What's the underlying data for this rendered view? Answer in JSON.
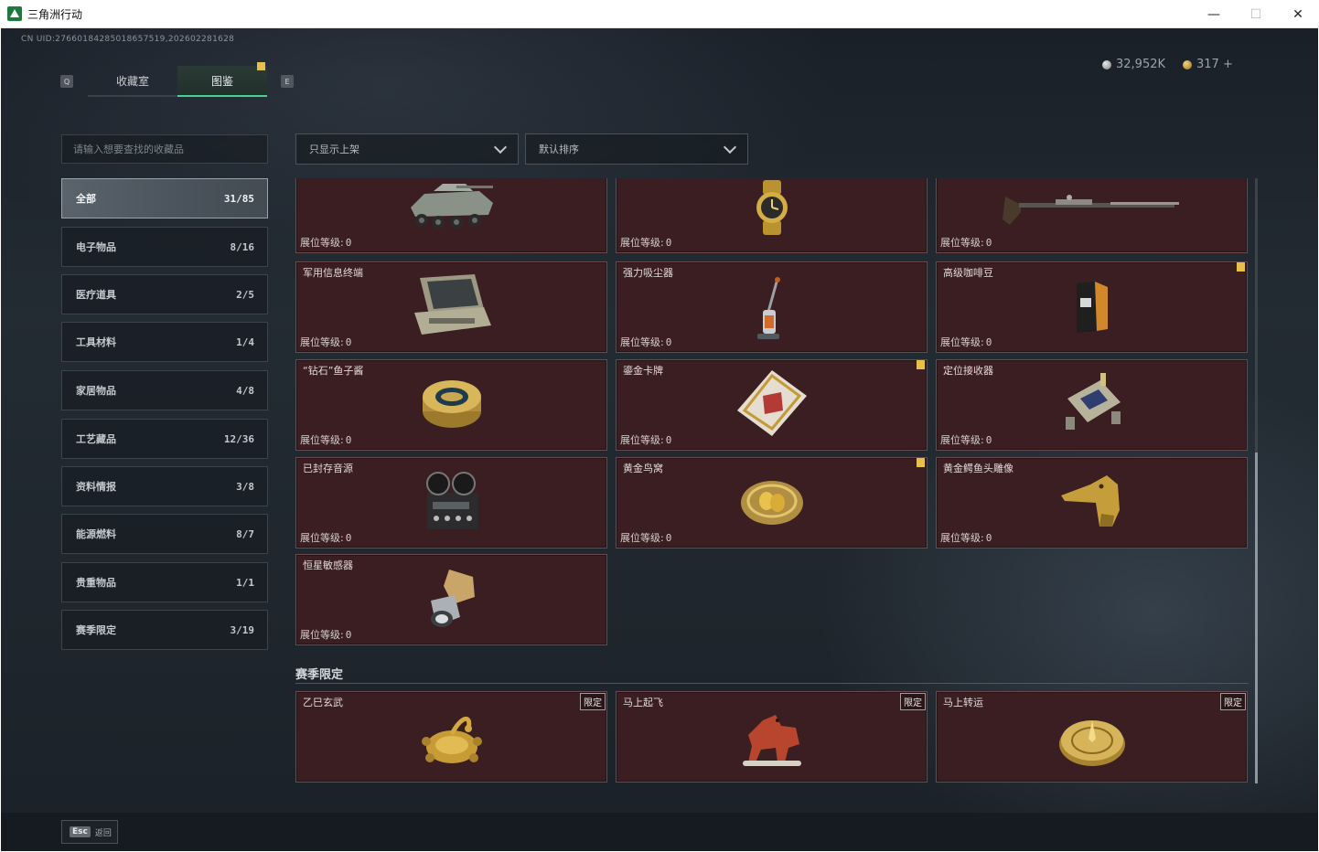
{
  "window": {
    "title": "三角洲行动",
    "minimize": "—",
    "maximize": "☐",
    "close": "✕"
  },
  "header": {
    "uid": "CN UID:2766018428501865751​9,202602281628",
    "currency": [
      {
        "icon": "silver-coin-icon",
        "value": "32,952K"
      },
      {
        "icon": "gold-coin-icon",
        "value": "317 +"
      }
    ],
    "tab_key_left": "Q",
    "tab_key_right": "E",
    "tabs": [
      {
        "label": "收藏室",
        "active": false
      },
      {
        "label": "图鉴",
        "active": true
      }
    ]
  },
  "sidebar": {
    "search_placeholder": "请输入想要查找的收藏品",
    "categories": [
      {
        "label": "全部",
        "count": "31/85",
        "active": true
      },
      {
        "label": "电子物品",
        "count": "8/16"
      },
      {
        "label": "医疗道具",
        "count": "2/5"
      },
      {
        "label": "工具材料",
        "count": "1/4"
      },
      {
        "label": "家居物品",
        "count": "4/8"
      },
      {
        "label": "工艺藏品",
        "count": "12/36"
      },
      {
        "label": "资料情报",
        "count": "3/8"
      },
      {
        "label": "能源燃料",
        "count": "8/7"
      },
      {
        "label": "贵重物品",
        "count": "1/1"
      },
      {
        "label": "赛季限定",
        "count": "3/19"
      }
    ]
  },
  "filters": {
    "show_filter": "只显示上架",
    "sort": "默认排序"
  },
  "level_label": "展位等级:",
  "items": [
    {
      "name": "",
      "level": "0",
      "icon": "armored-vehicle-icon",
      "flag": false
    },
    {
      "name": "",
      "level": "0",
      "icon": "gold-watch-icon",
      "flag": false
    },
    {
      "name": "",
      "level": "0",
      "icon": "musket-icon",
      "flag": false
    },
    {
      "name": "军用信息终端",
      "level": "0",
      "icon": "military-terminal-icon",
      "flag": false
    },
    {
      "name": "强力吸尘器",
      "level": "0",
      "icon": "vacuum-cleaner-icon",
      "flag": false
    },
    {
      "name": "高级咖啡豆",
      "level": "0",
      "icon": "coffee-bag-icon",
      "flag": true
    },
    {
      "name": "“钻石”鱼子酱",
      "level": "0",
      "icon": "caviar-tin-icon",
      "flag": false
    },
    {
      "name": "鎏金卡牌",
      "level": "0",
      "icon": "gilded-card-icon",
      "flag": true
    },
    {
      "name": "定位接收器",
      "level": "0",
      "icon": "locator-receiver-icon",
      "flag": false
    },
    {
      "name": "已封存音源",
      "level": "0",
      "icon": "tape-recorder-icon",
      "flag": false
    },
    {
      "name": "黄金鸟窝",
      "level": "0",
      "icon": "golden-nest-icon",
      "flag": true
    },
    {
      "name": "黄金鳄鱼头雕像",
      "level": "0",
      "icon": "crocodile-statue-icon",
      "flag": false
    },
    {
      "name": "恒星敏感器",
      "level": "0",
      "icon": "star-sensor-icon",
      "flag": false
    }
  ],
  "season": {
    "title": "赛季限定",
    "limited_label": "限定",
    "items": [
      {
        "name": "乙巳玄武",
        "icon": "golden-tortoise-icon"
      },
      {
        "name": "马上起飞",
        "icon": "red-horse-icon"
      },
      {
        "name": "马上转运",
        "icon": "golden-compass-icon"
      }
    ]
  },
  "footer": {
    "esc_key": "Esc",
    "esc_label": "返回"
  }
}
